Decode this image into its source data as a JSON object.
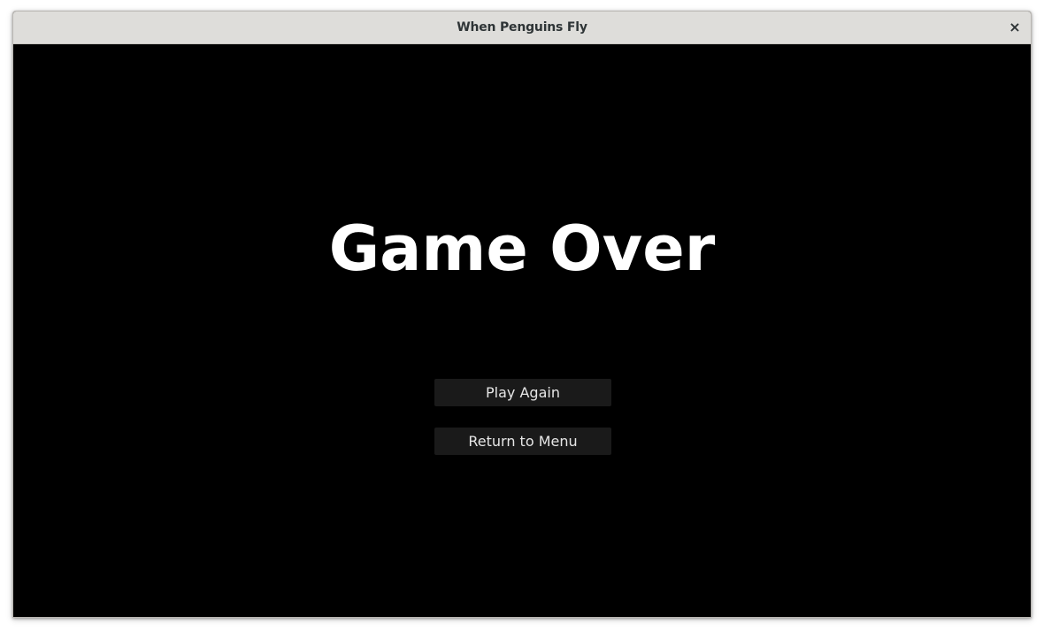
{
  "window": {
    "title": "When Penguins Fly",
    "close_icon": "×"
  },
  "game": {
    "heading": "Game Over",
    "buttons": {
      "play_again": "Play Again",
      "return_to_menu": "Return to Menu"
    }
  },
  "colors": {
    "titlebar": "#deddda",
    "background": "#000000",
    "heading": "#ffffff",
    "button_bg": "#1a1a1a",
    "button_text": "#e6e6e6"
  }
}
